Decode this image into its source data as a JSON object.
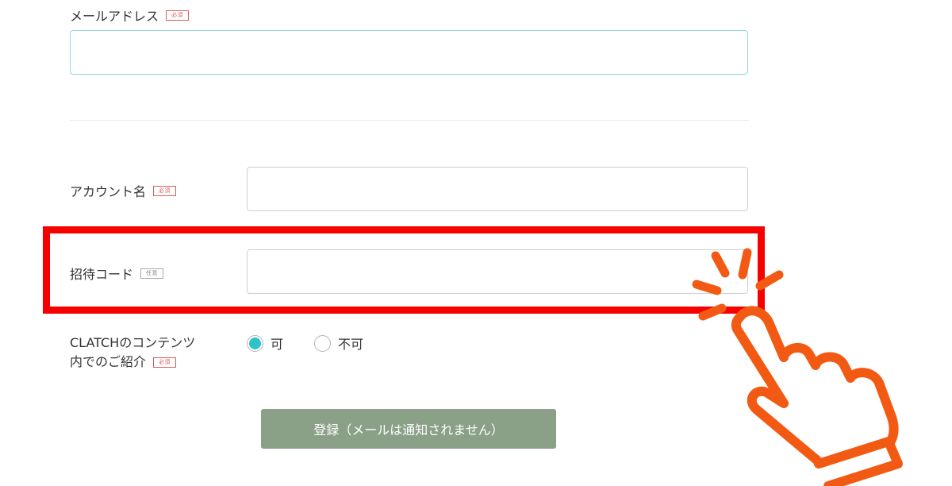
{
  "form": {
    "email": {
      "label": "メールアドレス",
      "badge": "必須",
      "value": ""
    },
    "account": {
      "label": "アカウント名",
      "badge": "必須",
      "value": ""
    },
    "invite": {
      "label": "招待コード",
      "badge": "任意",
      "value": ""
    },
    "intro": {
      "label_line1": "CLATCHのコンテンツ",
      "label_line2": "内でのご紹介",
      "badge": "必須",
      "options": [
        {
          "label": "可",
          "selected": true
        },
        {
          "label": "不可",
          "selected": false
        }
      ]
    },
    "submit_label": "登録（メールは通知されません）"
  },
  "colors": {
    "highlight": "#f70000",
    "hand_pointer": "#f25a14",
    "submit_bg": "#8aa087",
    "radio_selected": "#2ec2c9",
    "required_badge": "#e05a5a"
  },
  "icons": {
    "pointer": "hand-pointer-click-icon"
  }
}
